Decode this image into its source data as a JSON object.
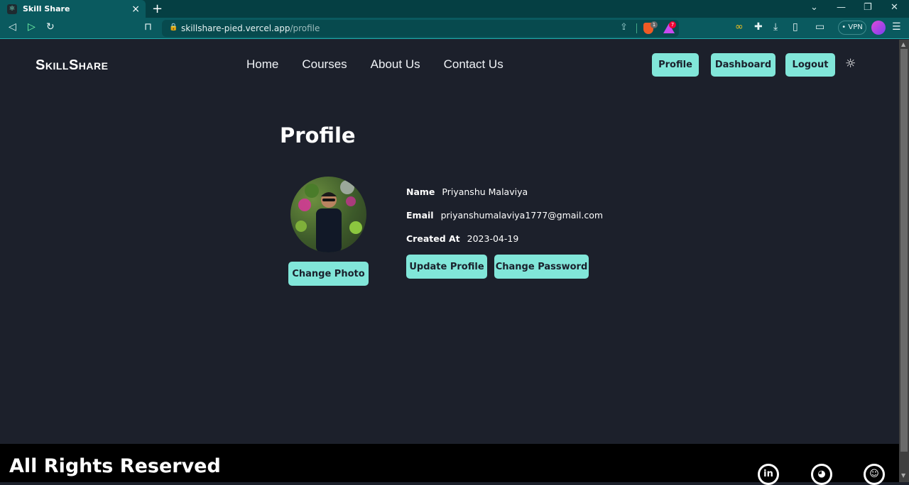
{
  "browser": {
    "tab_title": "Skill Share",
    "tab_close": "×",
    "new_tab": "+",
    "url_host": "skillshare-pied.vercel.app",
    "url_path": "/profile",
    "shields_badge": "1",
    "rewards_badge": "7",
    "vpn_label": "• VPN",
    "window_controls": {
      "dropdown": "⌄",
      "minimize": "—",
      "restore": "❐",
      "close": "✕"
    },
    "nav_icons": {
      "back": "◁",
      "forward": "▷",
      "reload": "↻",
      "bookmark": "⊓",
      "menu": "☰"
    }
  },
  "header": {
    "logo": "SkillShare",
    "nav": [
      "Home",
      "Courses",
      "About Us",
      "Contact Us"
    ],
    "buttons": {
      "profile": "Profile",
      "dashboard": "Dashboard",
      "logout": "Logout"
    },
    "theme_icon": "☼"
  },
  "profile": {
    "title": "Profile",
    "change_photo": "Change Photo",
    "fields": {
      "name_label": "Name",
      "name_value": "Priyanshu Malaviya",
      "email_label": "Email",
      "email_value": "priyanshumalaviya1777@gmail.com",
      "created_label": "Created At",
      "created_value": "2023-04-19"
    },
    "update_profile": "Update Profile",
    "change_password": "Change Password"
  },
  "footer": {
    "text": "All Rights Reserved",
    "social": [
      "in",
      "◕",
      "☺"
    ]
  },
  "colors": {
    "accent": "#81e6d9",
    "background": "#1c202b",
    "footer": "#000000",
    "chrome": "#0a5a5f"
  }
}
